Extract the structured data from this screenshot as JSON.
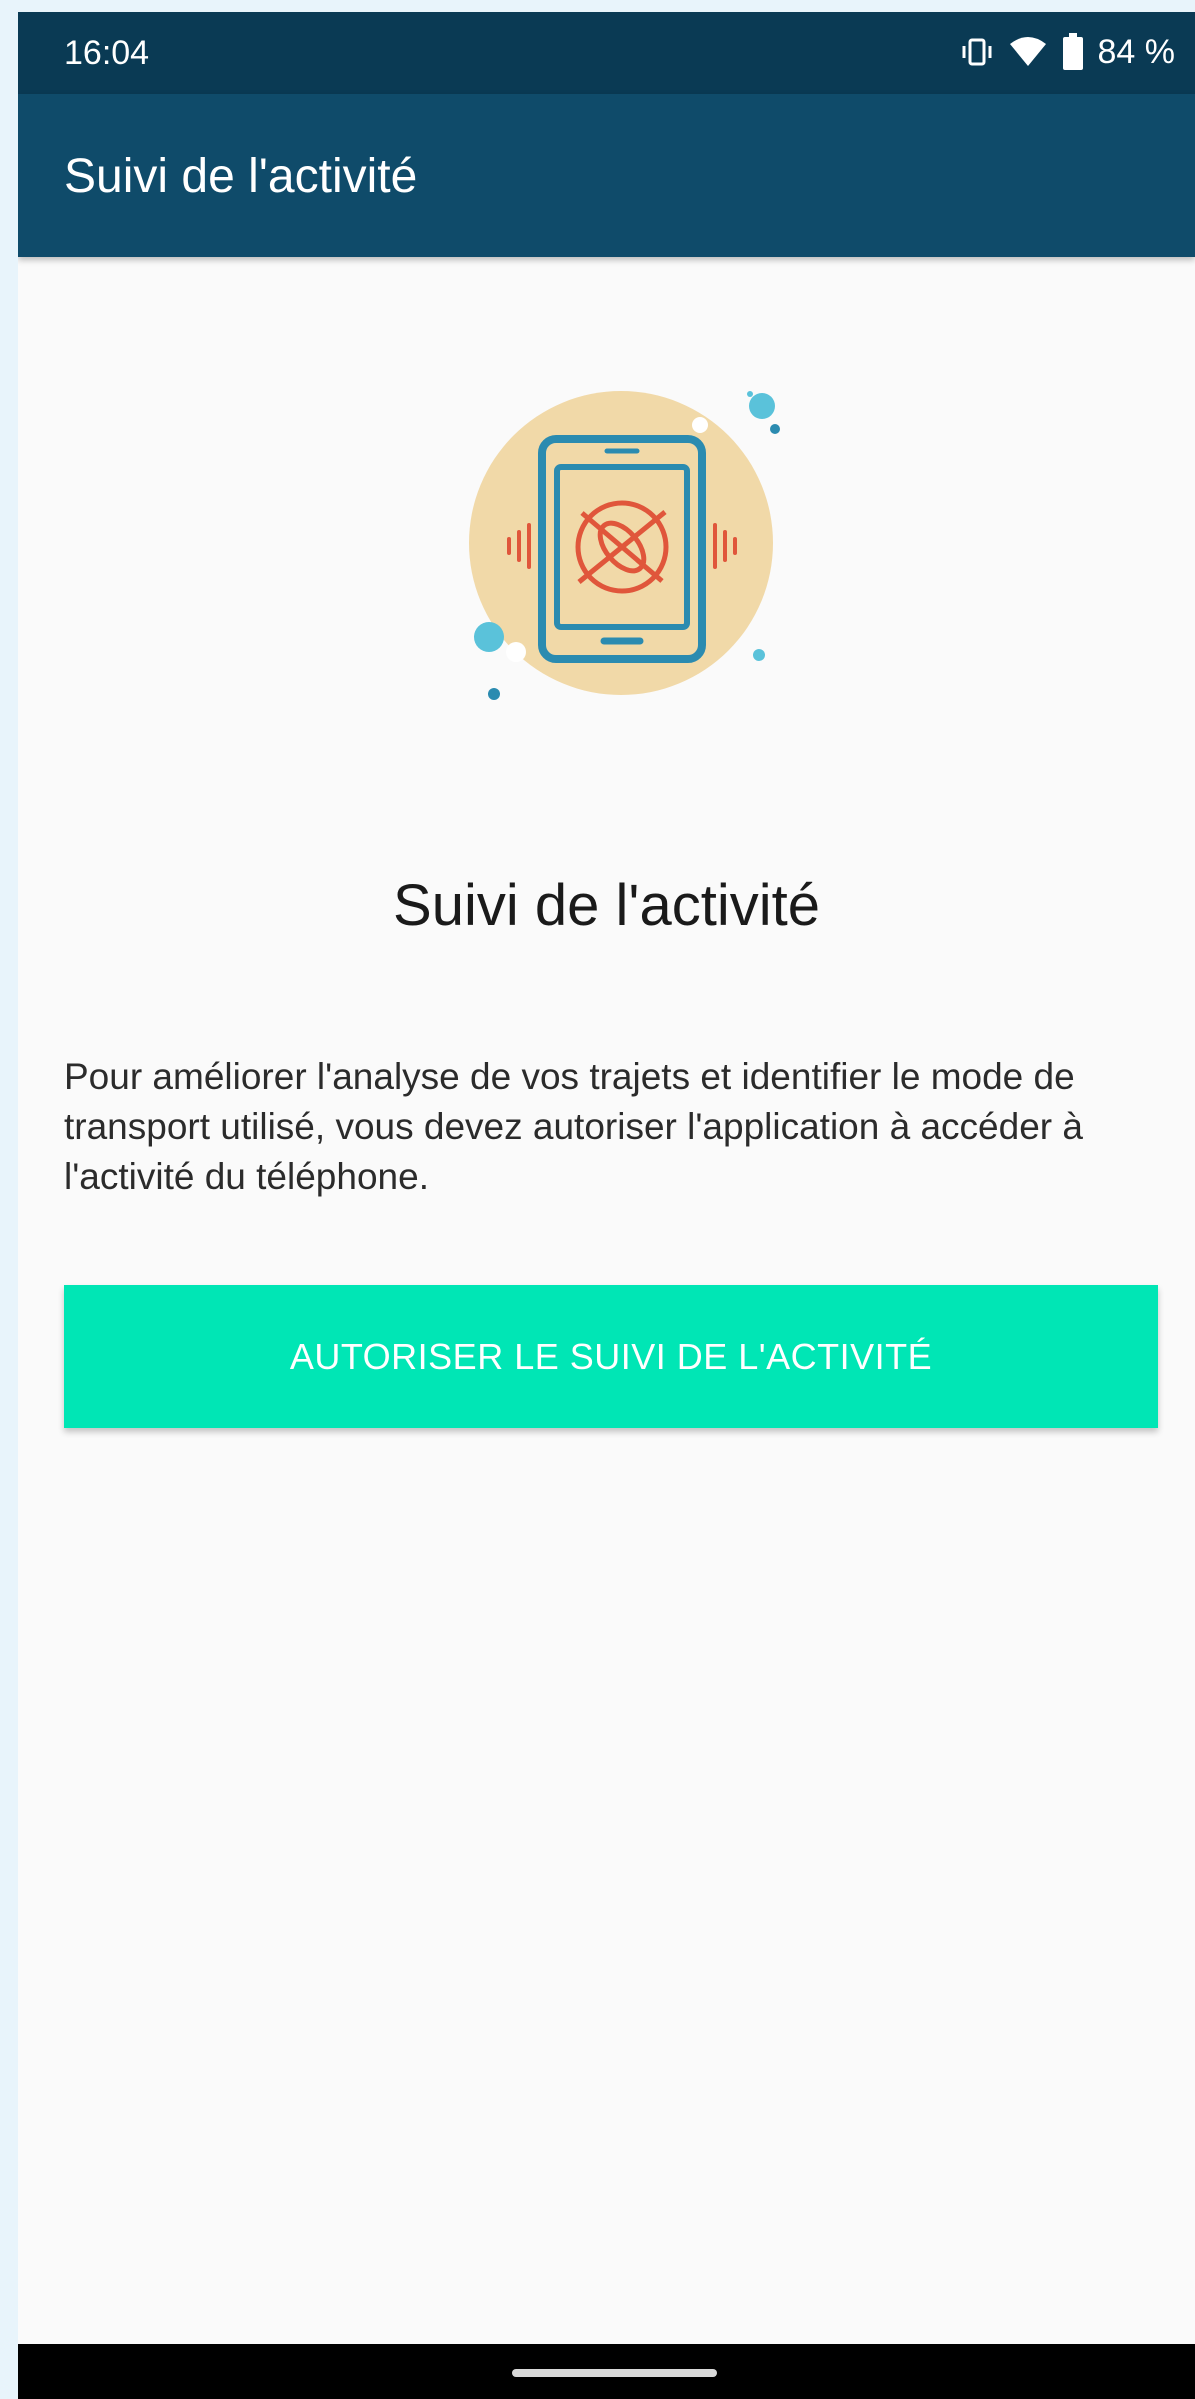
{
  "status_bar": {
    "time": "16:04",
    "battery": "84 %",
    "icons": [
      "vibrate-icon",
      "wifi-icon",
      "battery-icon"
    ]
  },
  "app_bar": {
    "title": "Suivi de l'activité"
  },
  "illustration": {
    "icon": "activity-tracking-phone-illustration",
    "colors": {
      "circle": "#f1d9a8",
      "phone": "#2b8bb0",
      "accent": "#e0563b",
      "dots": "#5ac2da"
    }
  },
  "content": {
    "heading": "Suivi de l'activité",
    "description": "Pour améliorer l'analyse de vos trajets et identifier le mode de transport utilisé, vous devez autoriser l'application à accéder à l'activité du téléphone.",
    "button_label": "AUTORISER LE SUIVI DE L'ACTIVITÉ"
  },
  "colors": {
    "status_bar": "#0a3a54",
    "app_bar": "#0f4b6a",
    "button": "#00e6b5",
    "background": "#fafafa"
  }
}
